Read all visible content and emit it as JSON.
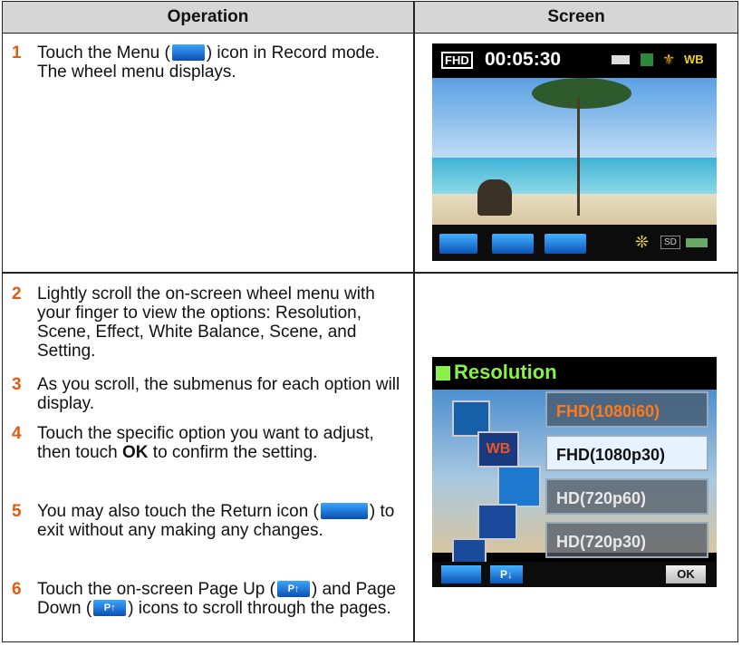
{
  "table": {
    "headers": [
      "Operation",
      "Screen"
    ]
  },
  "steps": [
    {
      "num": "1",
      "parts": [
        "Touch the Menu (",
        ") icon in Record mode. The wheel menu displays."
      ]
    },
    {
      "num": "2",
      "text": "Lightly scroll the on-screen wheel menu with your finger to view the options: Resolution, Scene, Effect, White Balance, Scene, and Setting."
    },
    {
      "num": "3",
      "text": "As you scroll, the submenus for each option will display."
    },
    {
      "num": "4",
      "parts": [
        "Touch the specific option you want to adjust, then touch ",
        "OK",
        " to confirm the setting."
      ]
    },
    {
      "num": "5",
      "parts": [
        "You may also touch the Return icon (",
        ") to exit without any making any changes."
      ]
    },
    {
      "num": "6",
      "parts": [
        "Touch the on-screen Page Up (",
        ") and Page Down (",
        ") icons to scroll through the pages."
      ]
    }
  ],
  "screen1": {
    "mode_badge": "FHD",
    "timer": "00:05:30",
    "wb_label": "WB",
    "sd_label": "SD"
  },
  "screen2": {
    "title": "Resolution",
    "options": [
      "FHD(1080i60)",
      "FHD(1080p30)",
      "HD(720p60)",
      "HD(720p30)"
    ],
    "page_label": "P↓",
    "ok_label": "OK"
  },
  "icons": {
    "page_label": "P↑"
  }
}
